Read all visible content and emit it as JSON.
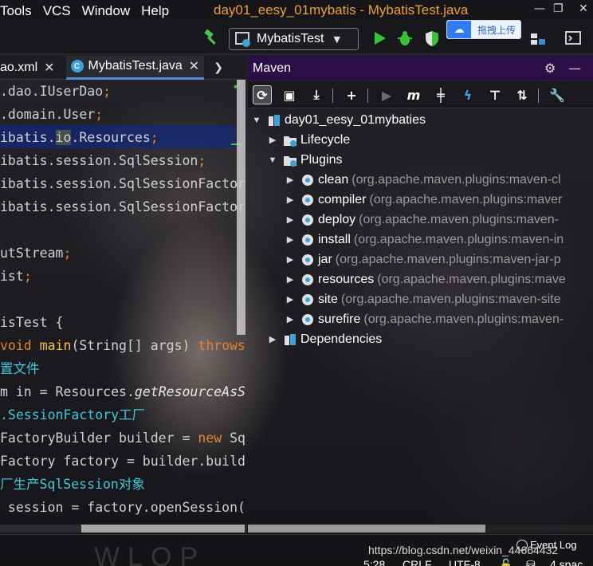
{
  "menu": [
    "Tools",
    "VCS",
    "Window",
    "Help"
  ],
  "window_title": "day01_eesy_01mybatis - MybatisTest.java",
  "toolbar": {
    "run_config": "MybatisTest",
    "upload_badge": "拖拽上传"
  },
  "editor_tabs": [
    {
      "label": "ao.xml",
      "active": false
    },
    {
      "label": "MybatisTest.java",
      "active": true
    }
  ],
  "code": {
    "l1": ".dao.IUserDao",
    "l2": ".domain.User",
    "l3a": "ibatis.",
    "l3b": "io",
    "l3c": ".Resources",
    "l4": "ibatis.session.SqlSession",
    "l5": "ibatis.session.SqlSessionFactor",
    "l6": "ibatis.session.SqlSessionFactor",
    "l7": "utStream",
    "l8": "ist",
    "l9": "isTest {",
    "l10_kw": "void",
    "l10_m": "main",
    "l10_args": "(String[] args)",
    "l10_throws": "throws",
    "l11": "置文件",
    "l12a": "m in = Resources.",
    "l12b": "getResourceAsS",
    "l13": ".SessionFactory工厂",
    "l14a": "FactoryBuilder builder = ",
    "l14b": "new",
    "l14c": " Sq",
    "l15": "Factory factory = builder.build",
    "l16": "厂生产SqlSession对象",
    "l17": " session = factory.openSession("
  },
  "maven": {
    "title": "Maven",
    "project": "day01_eesy_01mybaties",
    "lifecycle": "Lifecycle",
    "plugins": "Plugins",
    "plugin_items": [
      {
        "name": "clean",
        "desc": "(org.apache.maven.plugins:maven-cl"
      },
      {
        "name": "compiler",
        "desc": "(org.apache.maven.plugins:maver"
      },
      {
        "name": "deploy",
        "desc": "(org.apache.maven.plugins:maven-"
      },
      {
        "name": "install",
        "desc": "(org.apache.maven.plugins:maven-in"
      },
      {
        "name": "jar",
        "desc": "(org.apache.maven.plugins:maven-jar-p"
      },
      {
        "name": "resources",
        "desc": "(org.apache.maven.plugins:mave"
      },
      {
        "name": "site",
        "desc": "(org.apache.maven.plugins:maven-site"
      },
      {
        "name": "surefire",
        "desc": "(org.apache.maven.plugins:maven-"
      }
    ],
    "dependencies": "Dependencies"
  },
  "statusbar": {
    "event_log": "Event Log",
    "watermark": "https://blog.csdn.net/weixin_44664432",
    "wlop": "WLOP",
    "position": "5:28",
    "line_sep": "CRLF",
    "encoding": "UTF-8",
    "indent": "4 spac"
  },
  "colors": {
    "maven_header": "#2c0f46",
    "title": "#f0a030",
    "keyword": "#e8832a",
    "comment": "#41c8d8",
    "selection": "#14287a"
  }
}
